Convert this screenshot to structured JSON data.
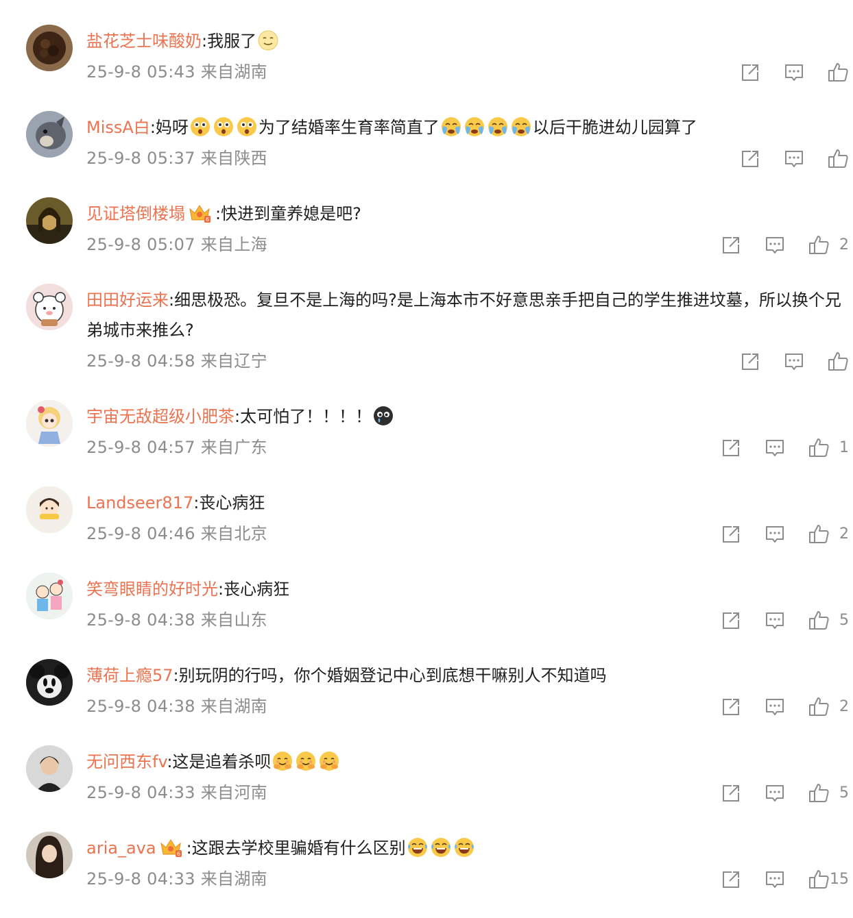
{
  "comments": [
    {
      "username": "盐花芝士味酸奶",
      "segments": [
        {
          "t": ":我服了"
        },
        {
          "emo": "awkward-face"
        }
      ],
      "time": "25-9-8 05:43",
      "location": "来自湖南",
      "likes": "",
      "avatar": "brown-bowl"
    },
    {
      "username": "MissA白",
      "segments": [
        {
          "t": ":妈呀"
        },
        {
          "emo": "shocked-face"
        },
        {
          "emo": "shocked-face"
        },
        {
          "emo": "shocked-face"
        },
        {
          "t": "为了结婚率生育率简直了"
        },
        {
          "emo": "crying-face"
        },
        {
          "emo": "crying-face"
        },
        {
          "emo": "crying-face"
        },
        {
          "emo": "crying-face"
        },
        {
          "t": "以后干脆进幼儿园算了"
        }
      ],
      "time": "25-9-8 05:37",
      "location": "来自陕西",
      "likes": "",
      "avatar": "gray-animal"
    },
    {
      "username": "见证塔倒楼塌",
      "badge": "vip-crown",
      "segments": [
        {
          "t": ":快进到童养媳是吧?"
        }
      ],
      "time": "25-9-8 05:07",
      "location": "来自上海",
      "likes": "2",
      "avatar": "painting-portrait"
    },
    {
      "username": "田田好运来",
      "segments": [
        {
          "t": ":细思极恐。复旦不是上海的吗?是上海本市不好意思亲手把自己的学生推进坟墓，所以换个兄弟城市来推么?"
        }
      ],
      "time": "25-9-8 04:58",
      "location": "来自辽宁",
      "likes": "",
      "avatar": "cartoon-bear"
    },
    {
      "username": "宇宙无敌超级小肥茶",
      "segments": [
        {
          "t": ":太可怕了！！！！"
        },
        {
          "emo": "tearful-dark-face"
        }
      ],
      "time": "25-9-8 04:57",
      "location": "来自广东",
      "likes": "1",
      "avatar": "doll"
    },
    {
      "username": "Landseer817",
      "segments": [
        {
          "t": ":丧心病狂"
        }
      ],
      "time": "25-9-8 04:46",
      "location": "来自北京",
      "likes": "2",
      "avatar": "cartoon-girl"
    },
    {
      "username": "笑弯眼睛的好时光",
      "segments": [
        {
          "t": ":丧心病狂"
        }
      ],
      "time": "25-9-8 04:38",
      "location": "来自山东",
      "likes": "5",
      "avatar": "cartoon-couple"
    },
    {
      "username": "薄荷上瘾57",
      "segments": [
        {
          "t": ":别玩阴的行吗，你个婚姻登记中心到底想干嘛别人不知道吗"
        }
      ],
      "time": "25-9-8 04:38",
      "location": "来自湖南",
      "likes": "2",
      "avatar": "mouse-character"
    },
    {
      "username": "无问西东fv",
      "segments": [
        {
          "t": ":这是追着杀呗"
        },
        {
          "emo": "hug-face"
        },
        {
          "emo": "hug-face"
        },
        {
          "emo": "hug-face"
        }
      ],
      "time": "25-9-8 04:33",
      "location": "来自河南",
      "likes": "5",
      "avatar": "young-man"
    },
    {
      "username": "aria_ava",
      "badge": "vip-crown",
      "segments": [
        {
          "t": ":这跟去学校里骗婚有什么区别"
        },
        {
          "emo": "laughing-tears-face"
        },
        {
          "emo": "laughing-tears-face"
        },
        {
          "emo": "laughing-tears-face"
        }
      ],
      "time": "25-9-8 04:33",
      "location": "来自湖南",
      "likes": "15",
      "avatar": "young-woman"
    }
  ],
  "icons": {
    "share": "share-icon",
    "comment": "comment-icon",
    "like": "thumbs-up-icon"
  },
  "colors": {
    "username": "#eb7350",
    "text": "#1f1f1f",
    "meta": "#8c8c8c",
    "icon": "#8c8c8c"
  }
}
